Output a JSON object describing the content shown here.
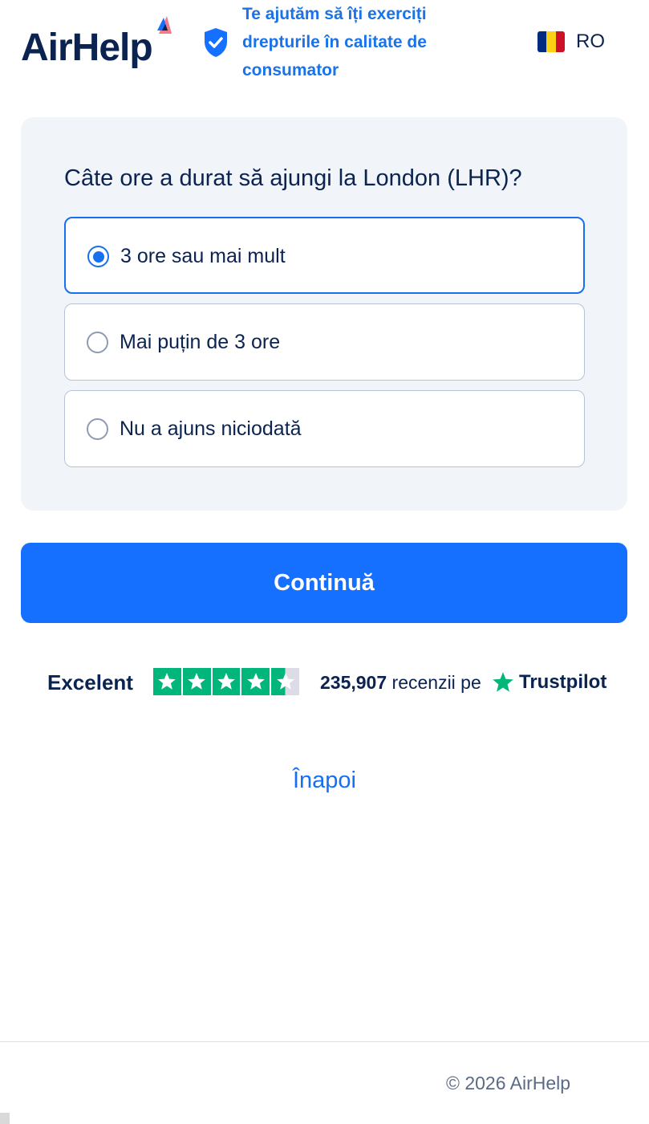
{
  "header": {
    "logo_text": "AirHelp",
    "tagline_lines": [
      "Te ajutăm să îți exerciți",
      "drepturile în calitate de",
      "consumator"
    ],
    "language_code": "RO",
    "flag_colors": [
      "#002b7f",
      "#fcd116",
      "#ce1126"
    ]
  },
  "question": {
    "title": "Câte ore a durat să ajungi la London (LHR)?",
    "options": [
      {
        "label": "3 ore sau mai mult",
        "selected": true
      },
      {
        "label": "Mai puțin de 3 ore",
        "selected": false
      },
      {
        "label": "Nu a ajuns niciodată",
        "selected": false
      }
    ]
  },
  "continue_label": "Continuă",
  "trustpilot": {
    "rating_word": "Excelent",
    "stars": 4.5,
    "review_count": "235,907",
    "reviews_text": "recenzii pe",
    "brand": "Trustpilot"
  },
  "back_label": "Înapoi",
  "footer": {
    "copyright": "© 2026 AirHelp"
  },
  "colors": {
    "accent": "#1670ff",
    "navy": "#0b2350",
    "trustpilot_green": "#00b67a"
  }
}
